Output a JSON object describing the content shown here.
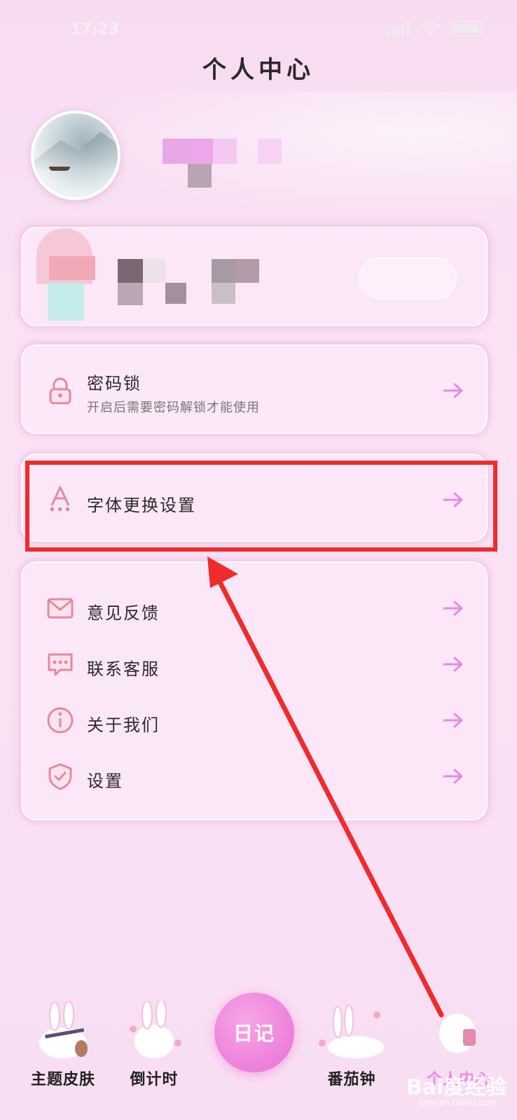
{
  "status_bar": {
    "time": "17:23"
  },
  "header": {
    "title": "个人中心"
  },
  "lock_item": {
    "label": "密码锁",
    "subtitle": "开启后需要密码解锁才能使用"
  },
  "font_item": {
    "label": "字体更换设置"
  },
  "list_items": [
    {
      "label": "意见反馈",
      "icon": "mail-icon"
    },
    {
      "label": "联系客服",
      "icon": "chat-icon"
    },
    {
      "label": "关于我们",
      "icon": "info-icon"
    },
    {
      "label": "设置",
      "icon": "shield-check-icon"
    }
  ],
  "tabbar": {
    "tabs": [
      {
        "label": "主题皮肤"
      },
      {
        "label": "倒计时"
      },
      {
        "label": "番茄钟"
      },
      {
        "label": "个人中心"
      }
    ],
    "center_label": "日记"
  },
  "watermark": {
    "text": "Bai度经验",
    "sub": "jingyan.baidu.com"
  },
  "colors": {
    "accent": "#ee7fd9",
    "highlight": "#ef2b2b",
    "icon": "#e28aa0",
    "arrow": "#e98ae0"
  }
}
